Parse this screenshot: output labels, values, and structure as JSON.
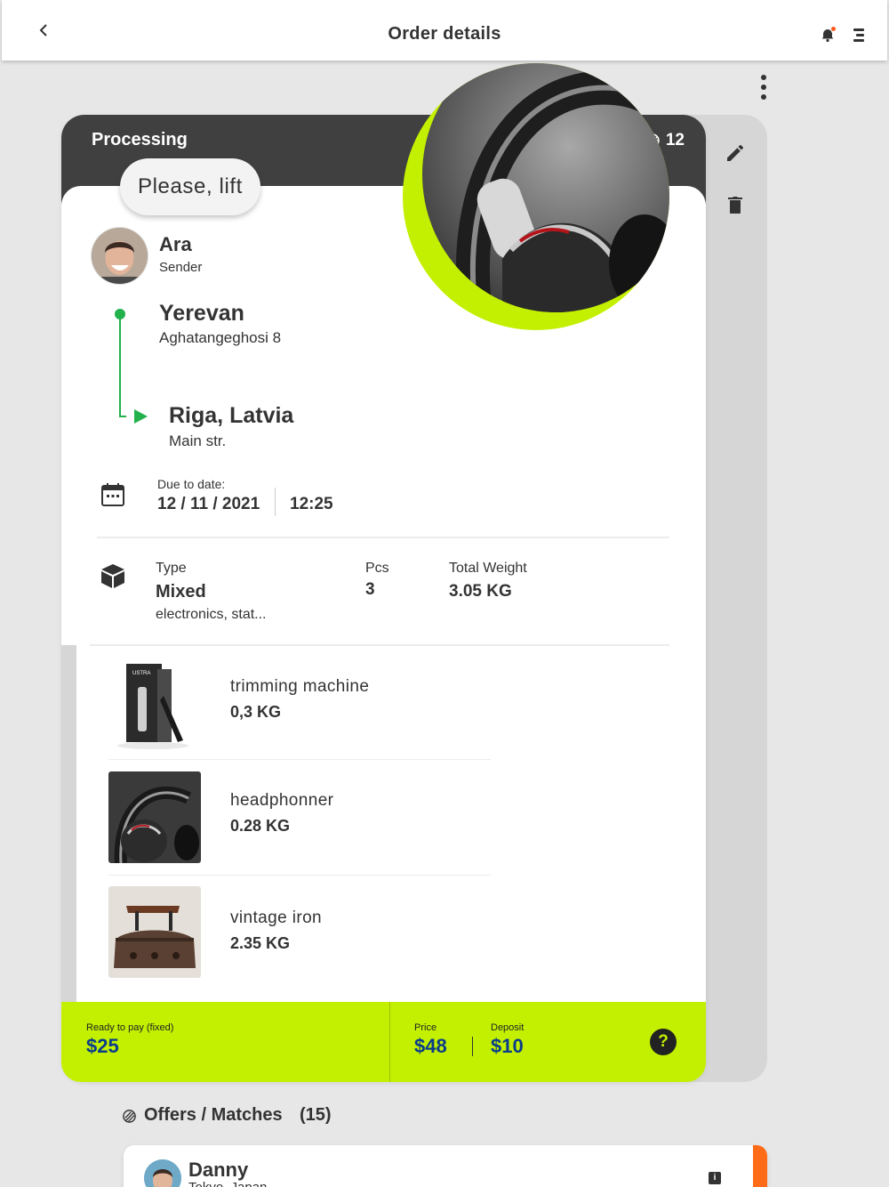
{
  "header": {
    "title": "Order details",
    "back_icon": "chevron-left-icon",
    "notification_icon": "bell-icon",
    "menu_icon": "menu-icon"
  },
  "order": {
    "status": "Processing",
    "count": "12",
    "note": "Please, lift",
    "sender": {
      "name": "Ara",
      "role": "Sender"
    },
    "route": {
      "from_city": "Yerevan",
      "from_address": "Aghatangeghosi 8",
      "to_city": "Riga, Latvia",
      "to_address": "Main str."
    },
    "due": {
      "label": "Due to date:",
      "date": "12 / 11 / 2021",
      "time": "12:25"
    },
    "details": {
      "type_label": "Type",
      "type_value": "Mixed",
      "type_desc": "electronics, stat...",
      "pcs_label": "Pcs",
      "pcs_value": "3",
      "weight_label": "Total Weight",
      "weight_value": "3.05 KG"
    },
    "items": [
      {
        "name": "trimming machine",
        "weight": "0,3 KG"
      },
      {
        "name": "headphonner",
        "weight": "0.28 KG"
      },
      {
        "name": "vintage iron",
        "weight": "2.35 KG"
      }
    ],
    "payment": {
      "ready_label": "Ready to pay (fixed)",
      "ready_value": "$25",
      "price_label": "Price",
      "price_value": "$48",
      "deposit_label": "Deposit",
      "deposit_value": "$10",
      "help": "?"
    }
  },
  "offers": {
    "title": "Offers / Matches",
    "count": "(15)",
    "first": {
      "name": "Danny",
      "sub": "Tokyo, Japan"
    }
  },
  "colors": {
    "accent": "#c3f000",
    "dark": "#404040",
    "route": "#22b14c",
    "money": "#0a3d8a",
    "offer_accent": "#ff6b17"
  }
}
